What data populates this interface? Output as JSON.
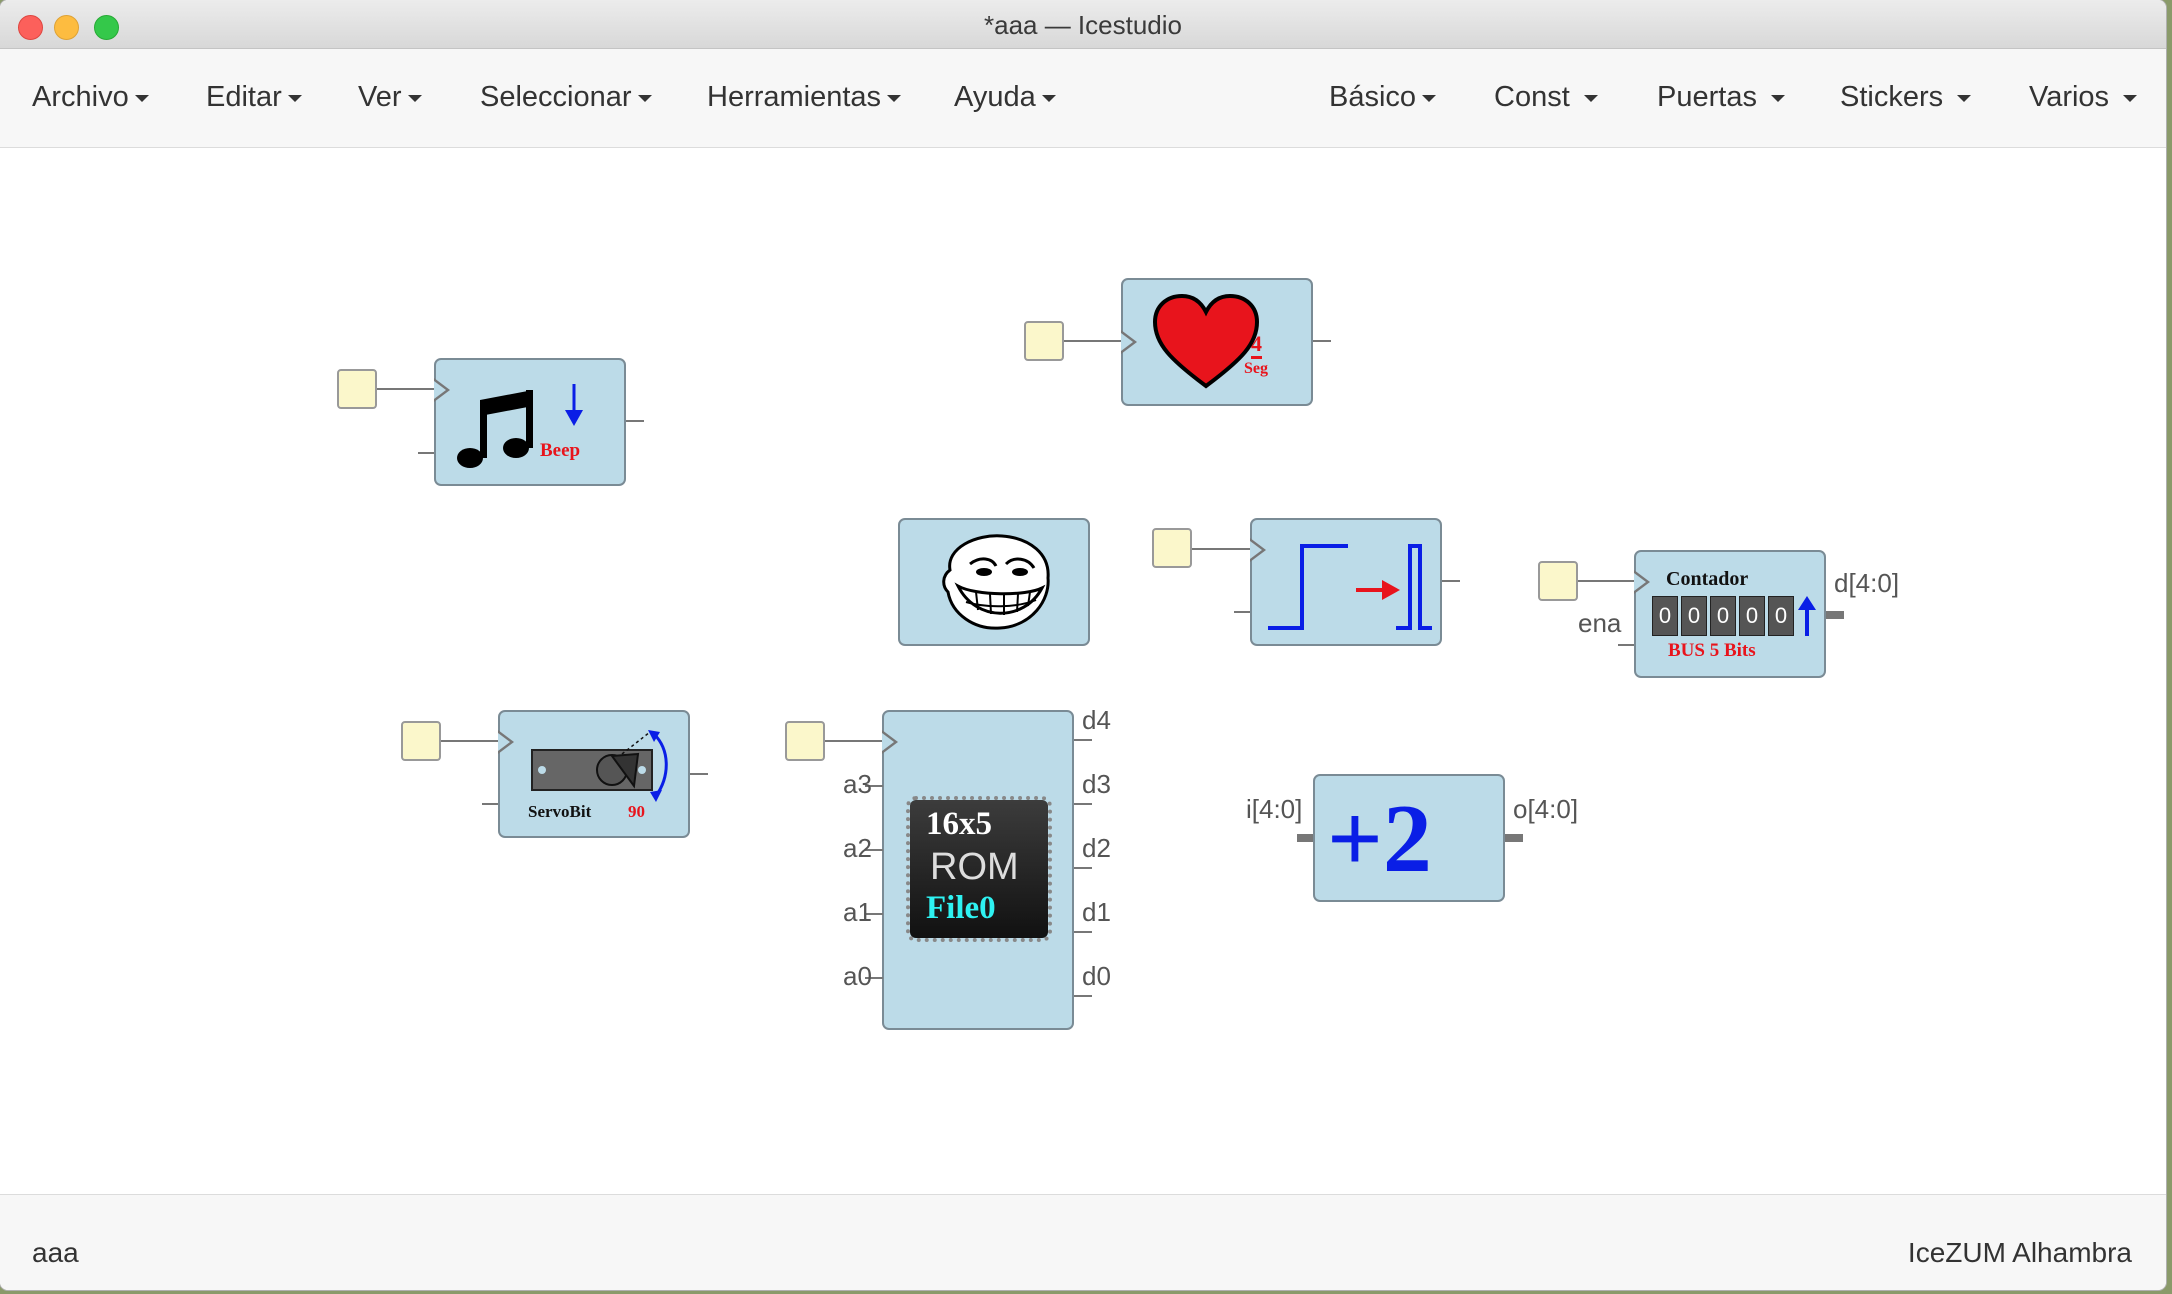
{
  "window": {
    "title": "*aaa — Icestudio"
  },
  "menus_left": [
    "Archivo",
    "Editar",
    "Ver",
    "Seleccionar",
    "Herramientas",
    "Ayuda"
  ],
  "menus_right": [
    "Básico",
    "Const",
    "Puertas",
    "Stickers",
    "Varios"
  ],
  "blocks": {
    "beep": {
      "label": "Beep"
    },
    "heartbeat": {
      "num": "4",
      "unit": "Seg"
    },
    "counter": {
      "title": "Contador",
      "digits": [
        "0",
        "0",
        "0",
        "0",
        "0"
      ],
      "subtitle": "BUS 5 Bits",
      "in_label": "ena",
      "out_label": "d[4:0]"
    },
    "servo": {
      "label": "ServoBit",
      "value": "90"
    },
    "rom": {
      "line1": "16x5",
      "line2": "ROM",
      "line3": "File0",
      "inputs": [
        "a3",
        "a2",
        "a1",
        "a0"
      ],
      "outputs": [
        "d4",
        "d3",
        "d2",
        "d1",
        "d0"
      ]
    },
    "adder": {
      "label": "+2",
      "in_label": "i[4:0]",
      "out_label": "o[4:0]"
    }
  },
  "status": {
    "left": "aaa",
    "right": "IceZUM Alhambra"
  },
  "colors": {
    "block_fill": "#bcdbe8",
    "input_port": "#fbf7cb",
    "accent_red": "#e8141c",
    "accent_blue": "#0a1ee6"
  }
}
